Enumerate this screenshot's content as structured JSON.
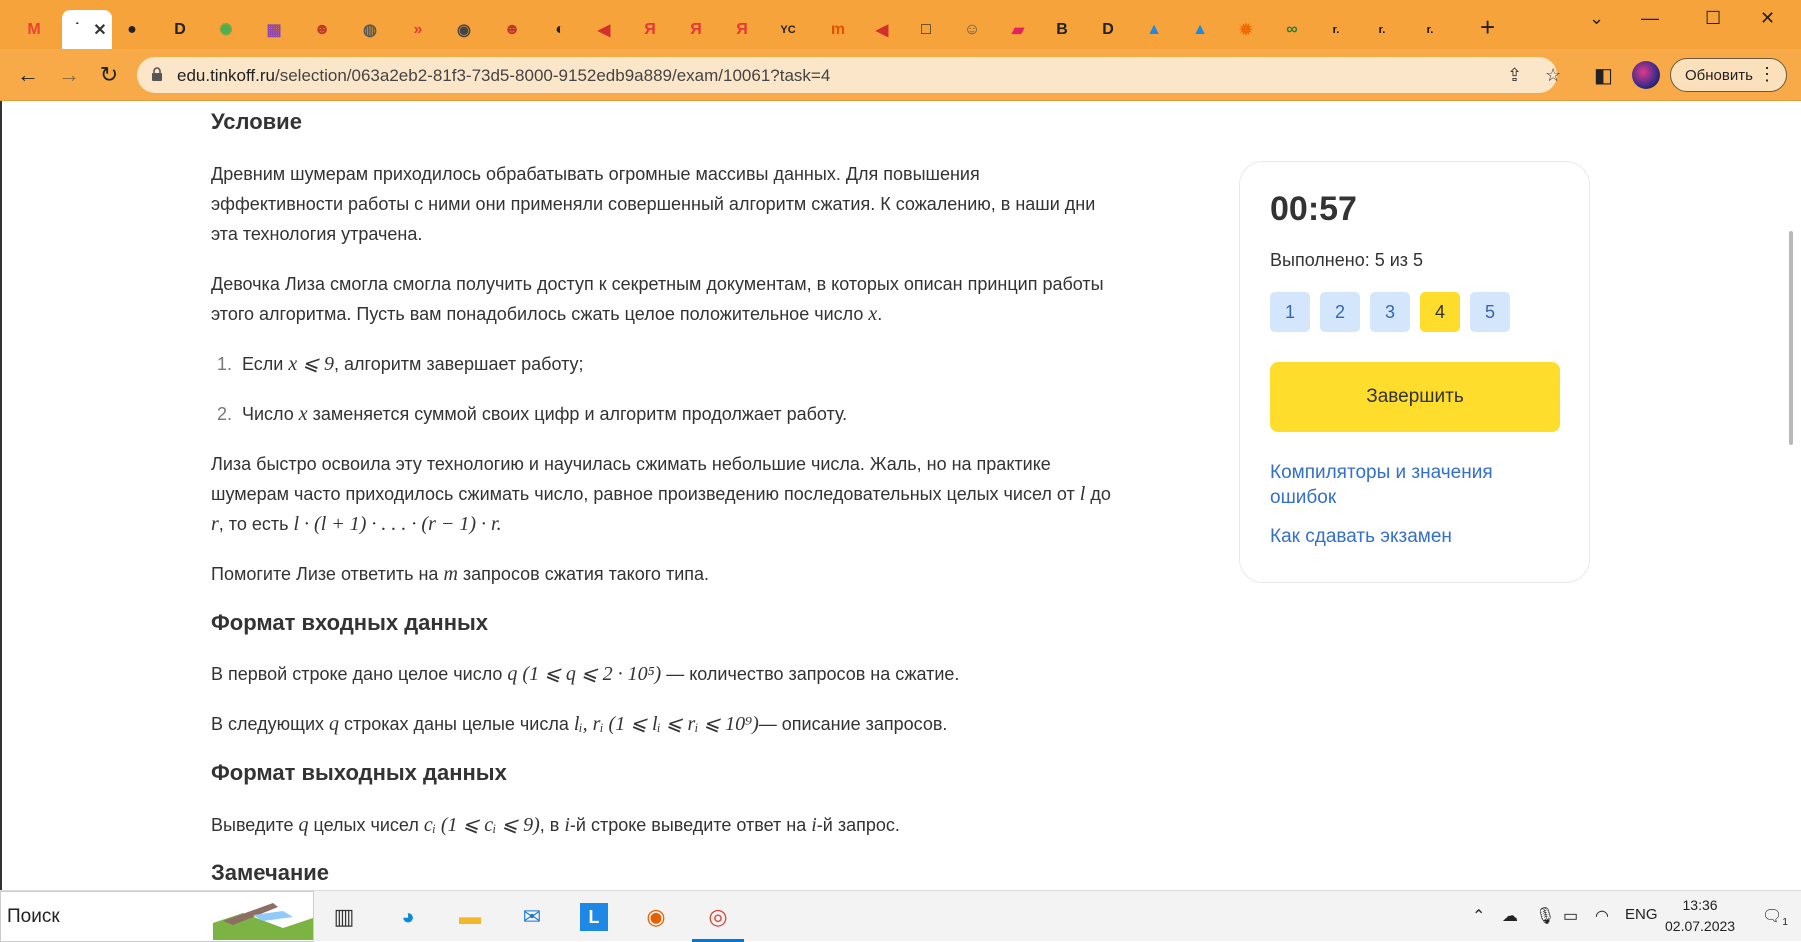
{
  "browser": {
    "tabs": [
      {
        "name": "gmail-tab",
        "glyph": "M",
        "color": "#ea4335"
      },
      {
        "name": "active-tab",
        "glyph": "˙",
        "color": "#333333"
      },
      {
        "name": "tab-3",
        "glyph": "●",
        "color": "#222222"
      },
      {
        "name": "tab-4",
        "glyph": "D",
        "color": "#222222"
      },
      {
        "name": "tab-5",
        "glyph": "✺",
        "color": "#4caf50"
      },
      {
        "name": "tab-6",
        "glyph": "▦",
        "color": "#8e44ad"
      },
      {
        "name": "tab-7",
        "glyph": "☻",
        "color": "#c0392b"
      },
      {
        "name": "tab-8",
        "glyph": "◍",
        "color": "#555555"
      },
      {
        "name": "tab-9",
        "glyph": "»",
        "color": "#e53935"
      },
      {
        "name": "tab-10",
        "glyph": "◉",
        "color": "#444444"
      },
      {
        "name": "tab-11",
        "glyph": "☻",
        "color": "#c0392b"
      },
      {
        "name": "tab-12",
        "glyph": "◐",
        "color": "#222222"
      },
      {
        "name": "tab-13",
        "glyph": "◀",
        "color": "#d32f2f"
      },
      {
        "name": "tab-14",
        "glyph": "Я",
        "color": "#e53935"
      },
      {
        "name": "tab-15",
        "glyph": "Я",
        "color": "#e53935"
      },
      {
        "name": "tab-16",
        "glyph": "Я",
        "color": "#e53935"
      },
      {
        "name": "tab-17",
        "glyph": "YC",
        "color": "#222222"
      },
      {
        "name": "tab-18",
        "glyph": "m",
        "color": "#e65100"
      },
      {
        "name": "tab-19",
        "glyph": "◀",
        "color": "#d32f2f"
      },
      {
        "name": "tab-20",
        "glyph": "□",
        "color": "#222222"
      },
      {
        "name": "tab-21",
        "glyph": "☺",
        "color": "#555555"
      },
      {
        "name": "tab-22",
        "glyph": "▰",
        "color": "#e91e63"
      },
      {
        "name": "tab-23",
        "glyph": "B",
        "color": "#222222"
      },
      {
        "name": "tab-24",
        "glyph": "D",
        "color": "#222222"
      },
      {
        "name": "tab-25",
        "glyph": "▲",
        "color": "#1e88e5"
      },
      {
        "name": "tab-26",
        "glyph": "▲",
        "color": "#1e88e5"
      },
      {
        "name": "tab-27",
        "glyph": "✹",
        "color": "#ef6c00"
      },
      {
        "name": "tab-28",
        "glyph": "∞",
        "color": "#2e7d32"
      },
      {
        "name": "tab-29",
        "glyph": "r.",
        "color": "#111111"
      },
      {
        "name": "tab-30",
        "glyph": "r.",
        "color": "#111111"
      },
      {
        "name": "tab-31",
        "glyph": "r.",
        "color": "#111111"
      }
    ],
    "active_tab_title": "˙",
    "url_host": "edu.tinkoff.ru",
    "url_path": "/selection/063a2eb2-81f3-73d5-8000-9152edb9a889/exam/10061?task=4",
    "update_label": "Обновить"
  },
  "statement": {
    "heading": "Условие",
    "p1": "Древним шумерам приходилось обрабатывать огромные массивы данных. Для повышения эффективности работы с ними они применяли совершенный алгоритм сжатия. К сожалению, в наши дни эта технология утрачена.",
    "p2_text": "Девочка Лиза смогла смогла получить доступ к секретным документам, в которых описан принцип работы этого алгоритма. Пусть вам понадобилось сжать целое положительное число ",
    "p2_var": "x",
    "p2_end": ".",
    "list": [
      {
        "num": "1.",
        "pre": "Если ",
        "math": "x ⩽ 9",
        "post": ", алгоритм завершает работу;"
      },
      {
        "num": "2.",
        "pre": "Число ",
        "math": "x",
        "post": " заменяется суммой своих цифр и алгоритм продолжает работу."
      }
    ],
    "p3_text": "Лиза быстро освоила эту технологию и научилась сжимать небольшие числа. Жаль, но на практике шумерам часто приходилось сжимать число, равное произведению последовательных целых чисел от ",
    "p3_l": "l",
    "p3_mid": " до ",
    "p3_r": "r",
    "p3_then": ", то есть ",
    "p3_formula": "l · (l + 1) · . . . · (r − 1) · r.",
    "p4_pre": "Помогите Лизе ответить на ",
    "p4_var": "m",
    "p4_post": " запросов сжатия такого типа."
  },
  "input_format": {
    "heading": "Формат входных данных",
    "line1_pre": "В первой строке дано целое число ",
    "line1_math": "q (1 ⩽ q ⩽ 2 · 10⁵)",
    "line1_post": " — количество запросов на сжатие.",
    "line2_pre": "В следующих ",
    "line2_var": "q",
    "line2_mid": " строках даны целые числа ",
    "line2_math": "lᵢ, rᵢ (1 ⩽ lᵢ ⩽ rᵢ ⩽ 10⁹)",
    "line2_post": "— описание запросов."
  },
  "output_format": {
    "heading": "Формат выходных данных",
    "line_pre": "Выведите ",
    "line_var": "q",
    "line_mid": " целых чисел ",
    "line_math": "cᵢ (1 ⩽ cᵢ ⩽ 9)",
    "line_mid2": ", в ",
    "line_i": "i",
    "line_mid3": "-й строке выведите ответ на ",
    "line_i2": "i",
    "line_post": "-й запрос."
  },
  "note": {
    "heading": "Замечание"
  },
  "sidebar": {
    "timer": "00:57",
    "done": "Выполнено: 5 из 5",
    "questions": [
      "1",
      "2",
      "3",
      "4",
      "5"
    ],
    "current_question": "4",
    "finish_label": "Завершить",
    "link1": "Компиляторы и значения ошибок",
    "link2": "Как сдавать экзамен"
  },
  "taskbar": {
    "search_placeholder": "Поиск",
    "lang": "ENG",
    "time": "13:36",
    "date": "02.07.2023",
    "notif_count": "1"
  }
}
